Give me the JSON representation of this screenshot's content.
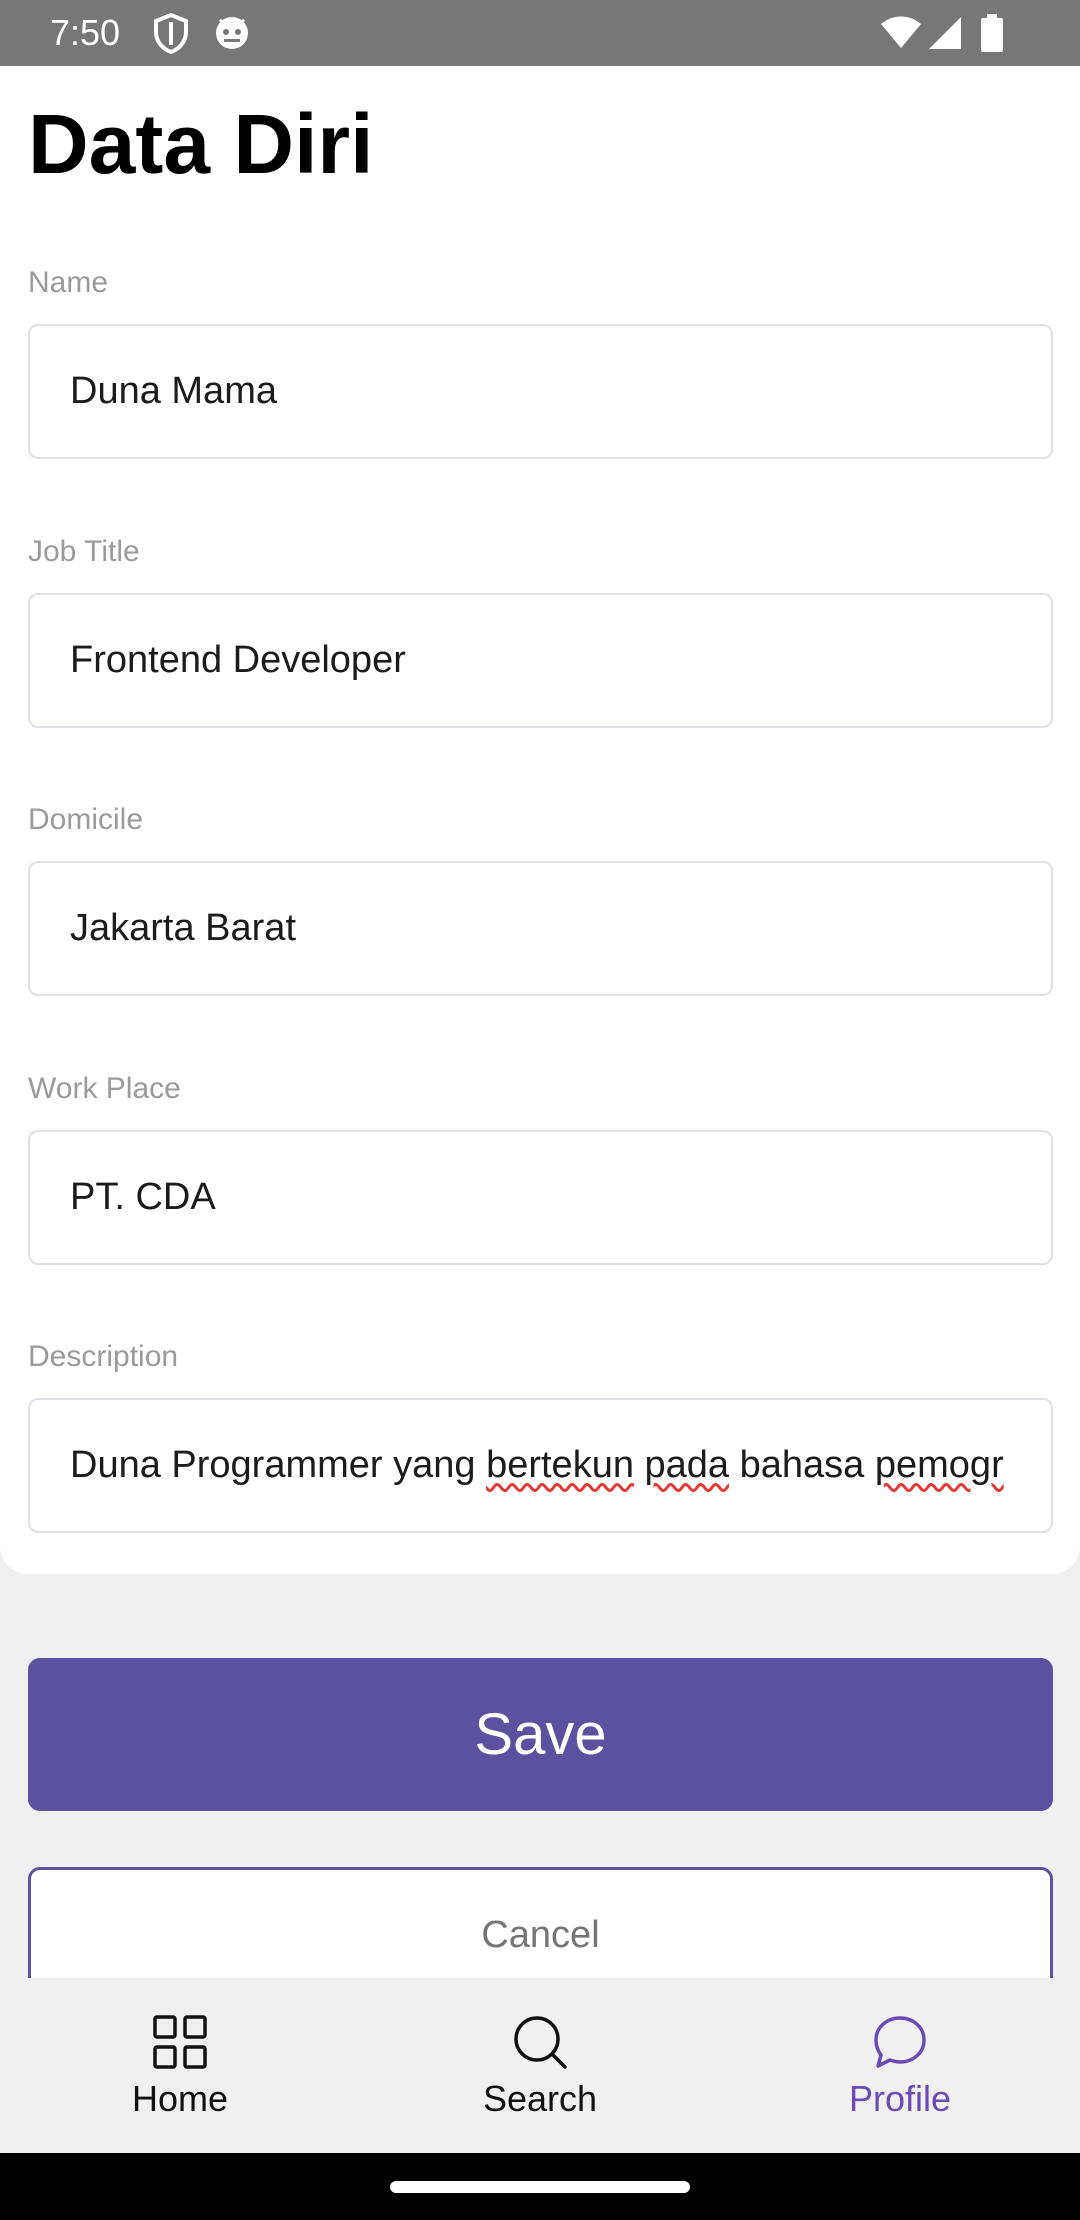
{
  "status_bar": {
    "time": "7:50",
    "icons": [
      "shield-icon",
      "robot-face-icon",
      "wifi-icon",
      "cellular-signal-icon",
      "battery-icon"
    ]
  },
  "page": {
    "title": "Data Diri"
  },
  "form": {
    "name": {
      "label": "Name",
      "value": "Duna Mama"
    },
    "job_title": {
      "label": "Job Title",
      "value": "Frontend Developer"
    },
    "domicile": {
      "label": "Domicile",
      "value": "Jakarta Barat"
    },
    "work_place": {
      "label": "Work Place",
      "value": "PT. CDA"
    },
    "description": {
      "label": "Description",
      "value_parts": [
        "Duna Programmer yang ",
        "bertekun",
        " ",
        "pada",
        " bahasa ",
        "pemogr"
      ]
    }
  },
  "actions": {
    "save_label": "Save",
    "cancel_label": "Cancel"
  },
  "bottom_nav": {
    "items": [
      {
        "label": "Home",
        "icon": "grid-icon"
      },
      {
        "label": "Search",
        "icon": "search-icon"
      },
      {
        "label": "Profile",
        "icon": "chat-bubble-icon",
        "active": true
      }
    ]
  },
  "colors": {
    "accent": "#5c519f",
    "active_nav": "#6a4bb5",
    "status_bar": "#777777",
    "field_border": "#e0dfe3",
    "label_gray": "#9a9a9a"
  }
}
